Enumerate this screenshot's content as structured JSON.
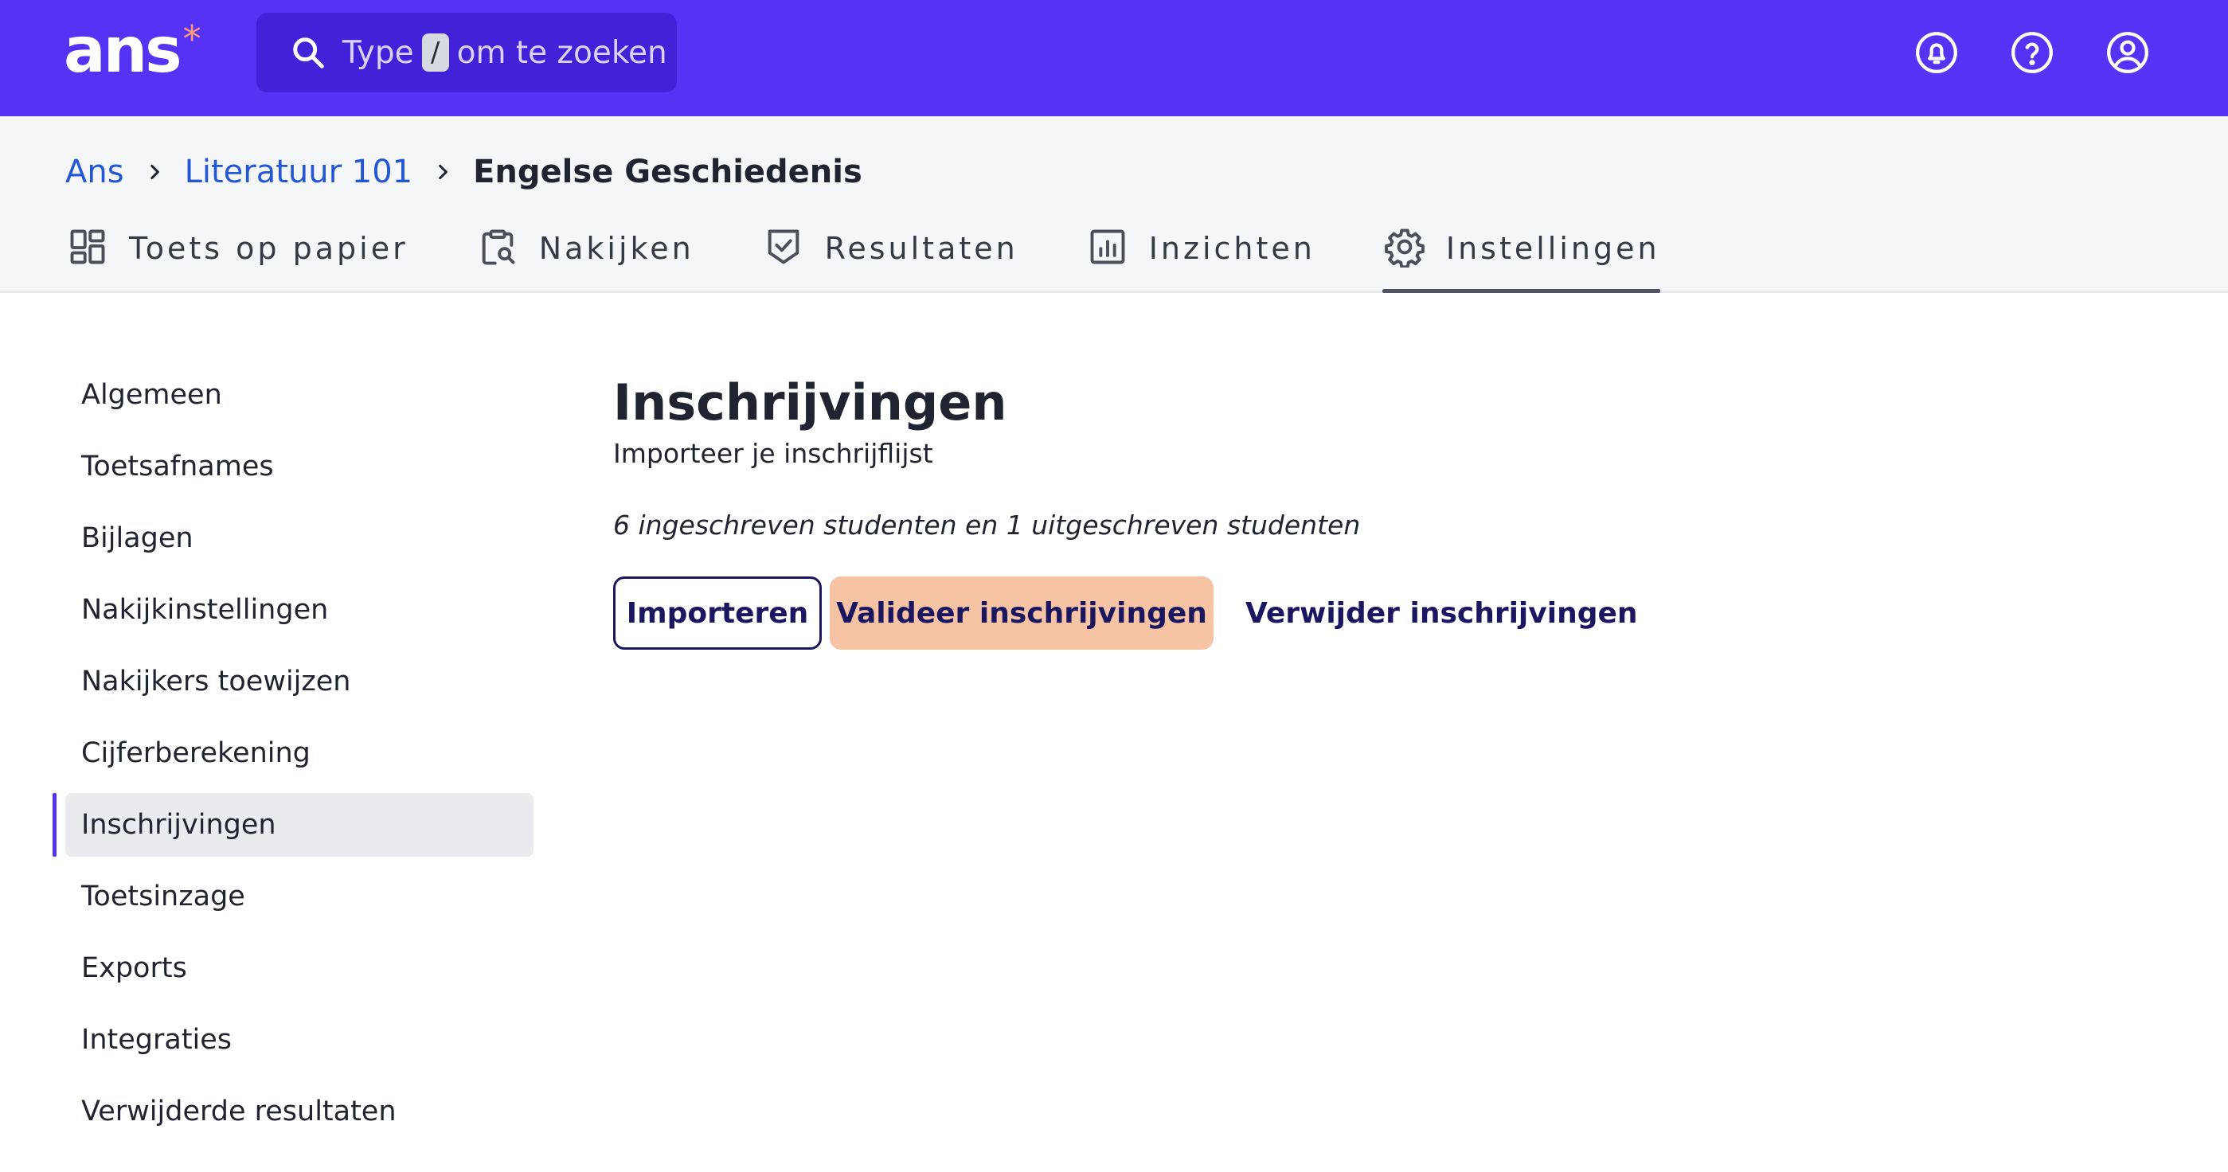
{
  "topbar": {
    "logo": "ans",
    "search": {
      "prefix": "Type",
      "shortcut": "/",
      "suffix": "om te zoeken"
    },
    "icons": [
      "notifications-icon",
      "help-icon",
      "account-icon"
    ]
  },
  "breadcrumb": {
    "items": [
      {
        "label": "Ans"
      },
      {
        "label": "Literatuur 101"
      },
      {
        "label": "Engelse Geschiedenis"
      }
    ]
  },
  "tabs": [
    {
      "label": "Toets op papier",
      "icon": "dashboard-icon"
    },
    {
      "label": "Nakijken",
      "icon": "clipboard-search-icon"
    },
    {
      "label": "Resultaten",
      "icon": "shield-check-icon"
    },
    {
      "label": "Inzichten",
      "icon": "bar-chart-icon"
    },
    {
      "label": "Instellingen",
      "icon": "gear-icon",
      "active": true
    }
  ],
  "sidebar": {
    "items": [
      {
        "label": "Algemeen"
      },
      {
        "label": "Toetsafnames"
      },
      {
        "label": "Bijlagen"
      },
      {
        "label": "Nakijkinstellingen"
      },
      {
        "label": "Nakijkers toewijzen"
      },
      {
        "label": "Cijferberekening"
      },
      {
        "label": "Inschrijvingen",
        "active": true
      },
      {
        "label": "Toetsinzage"
      },
      {
        "label": "Exports"
      },
      {
        "label": "Integraties"
      },
      {
        "label": "Verwijderde resultaten"
      }
    ]
  },
  "main": {
    "title": "Inschrijvingen",
    "subtitle": "Importeer je inschrijflijst",
    "summary": "6 ingeschreven studenten en 1 uitgeschreven studenten",
    "buttons": {
      "import": "Importeren",
      "validate": "Valideer inschrijvingen",
      "delete": "Verwijder inschrijvingen"
    }
  },
  "colors": {
    "brand": "#5632f5",
    "search_bg": "#4221d8",
    "link": "#2457d6",
    "button_text": "#1b1660",
    "validate_bg": "#f6c4a5",
    "logo_accent": "#ff9b7a"
  }
}
